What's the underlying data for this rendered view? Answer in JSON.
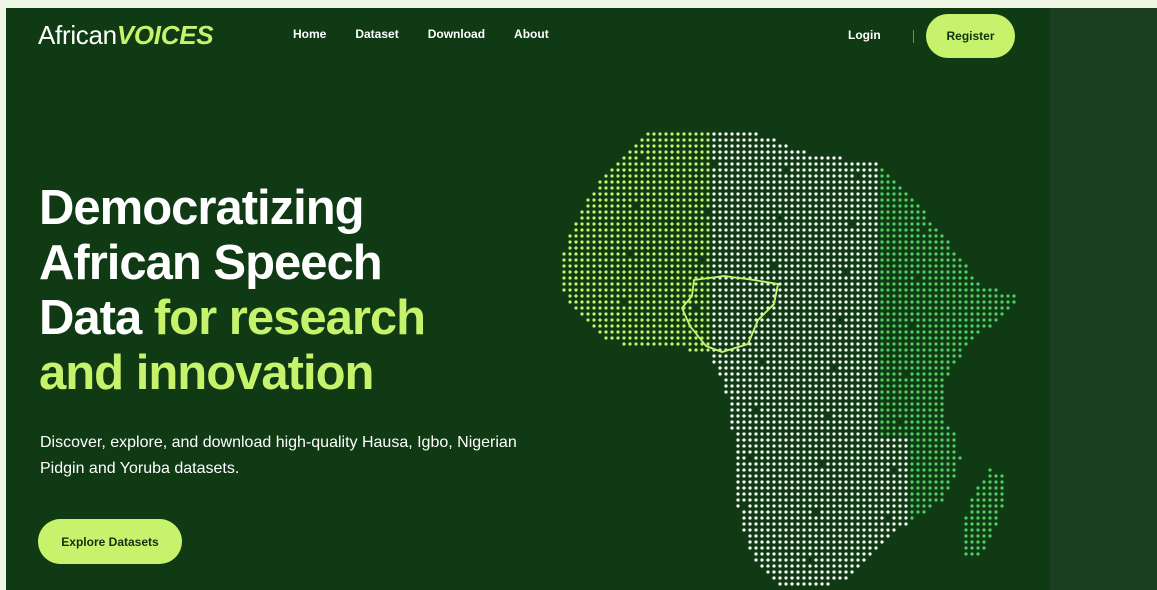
{
  "header": {
    "logo_main": "African",
    "logo_accent": "VOICES",
    "nav": [
      {
        "label": "Home"
      },
      {
        "label": "Dataset"
      },
      {
        "label": "Download"
      },
      {
        "label": "About"
      }
    ],
    "login_label": "Login",
    "register_label": "Register"
  },
  "hero": {
    "title_line1": "Democratizing",
    "title_line2": "African Speech",
    "title_line3_plain": "Data ",
    "title_line3_accent": "for research",
    "title_line4_accent": "and innovation",
    "subtitle": "Discover, explore, and download high-quality Hausa, Igbo, Nigerian Pidgin and Yoruba datasets.",
    "cta_label": "Explore Datasets"
  },
  "map": {
    "icon": "africa-dot-map",
    "colors": {
      "west": "#c6f36b",
      "east": "#4fd063",
      "center": "#ffffff",
      "nigeria_outline": "#c6f36b"
    }
  },
  "colors": {
    "background": "#0f3a13",
    "accent": "#c6f36b",
    "text": "#ffffff"
  }
}
